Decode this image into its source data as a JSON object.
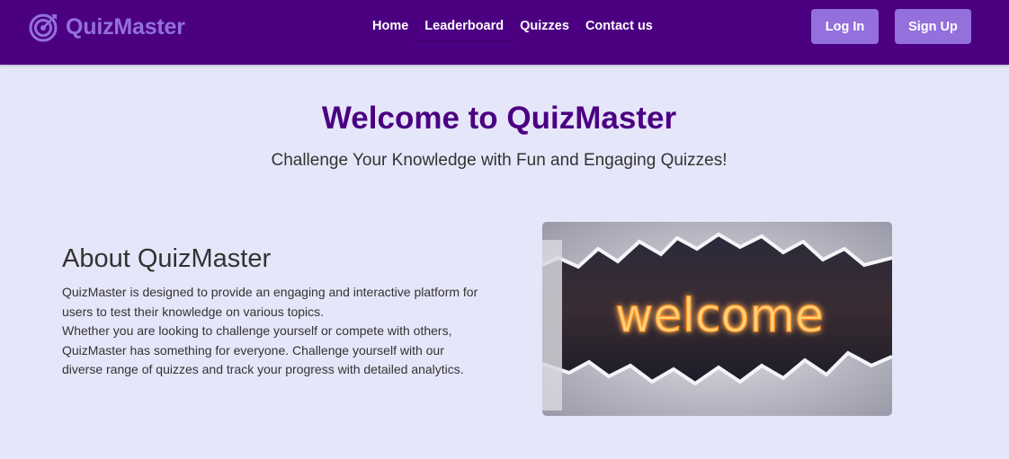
{
  "brand": {
    "name": "QuizMaster",
    "icon": "target-icon"
  },
  "nav": {
    "links": [
      {
        "label": "Home"
      },
      {
        "label": "Leaderboard"
      },
      {
        "label": "Quizzes"
      },
      {
        "label": "Contact us"
      }
    ],
    "login_label": "Log In",
    "signup_label": "Sign Up"
  },
  "hero": {
    "title": "Welcome to QuizMaster",
    "subtitle": "Challenge Your Knowledge with Fun and Engaging Quizzes!"
  },
  "about": {
    "title": "About QuizMaster",
    "lines": [
      "QuizMaster is designed to provide an engaging and interactive platform for",
      "users to test their knowledge on various topics.",
      "Whether you are looking to challenge yourself or compete with others,",
      "QuizMaster has something for everyone. Challenge yourself with our",
      "diverse range of quizzes and track your progress with detailed analytics."
    ]
  },
  "image": {
    "text": "welcome"
  },
  "colors": {
    "navbar": "#4b0082",
    "accent": "#9370db",
    "background": "#e6e6fa",
    "heading": "#4b0082",
    "body_text": "#333333"
  }
}
